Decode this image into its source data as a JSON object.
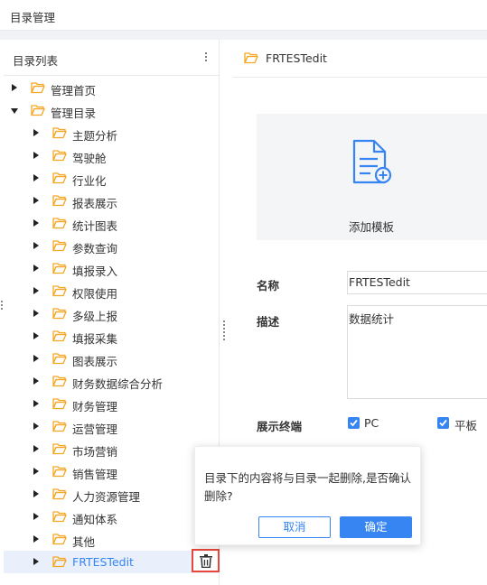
{
  "page": {
    "title": "目录管理"
  },
  "colors": {
    "accent": "#3685f2",
    "folder": "#f5a623",
    "danger": "#e8473c"
  },
  "left_panel": {
    "title": "目录列表",
    "more_icon": "vertical-dots-icon",
    "tree": [
      {
        "label": "管理首页",
        "level": 0,
        "expanded": false
      },
      {
        "label": "管理目录",
        "level": 0,
        "expanded": true
      },
      {
        "label": "主题分析",
        "level": 1,
        "expanded": false
      },
      {
        "label": "驾驶舱",
        "level": 1,
        "expanded": false
      },
      {
        "label": "行业化",
        "level": 1,
        "expanded": false
      },
      {
        "label": "报表展示",
        "level": 1,
        "expanded": false
      },
      {
        "label": "统计图表",
        "level": 1,
        "expanded": false
      },
      {
        "label": "参数查询",
        "level": 1,
        "expanded": false
      },
      {
        "label": "填报录入",
        "level": 1,
        "expanded": false
      },
      {
        "label": "权限使用",
        "level": 1,
        "expanded": false
      },
      {
        "label": "多级上报",
        "level": 1,
        "expanded": false
      },
      {
        "label": "填报采集",
        "level": 1,
        "expanded": false
      },
      {
        "label": "图表展示",
        "level": 1,
        "expanded": false
      },
      {
        "label": "财务数据综合分析",
        "level": 1,
        "expanded": false
      },
      {
        "label": "财务管理",
        "level": 1,
        "expanded": false
      },
      {
        "label": "运营管理",
        "level": 1,
        "expanded": false
      },
      {
        "label": "市场营销",
        "level": 1,
        "expanded": false
      },
      {
        "label": "销售管理",
        "level": 1,
        "expanded": false
      },
      {
        "label": "人力资源管理",
        "level": 1,
        "expanded": false
      },
      {
        "label": "通知体系",
        "level": 1,
        "expanded": false
      },
      {
        "label": "其他",
        "level": 1,
        "expanded": false
      },
      {
        "label": "FRTESTedit",
        "level": 1,
        "expanded": false,
        "selected": true
      }
    ],
    "delete_icon": "trash-icon"
  },
  "right_panel": {
    "folder_name": "FRTESTedit",
    "template_card": {
      "label": "添加模板",
      "icon": "add-document-icon"
    },
    "form": {
      "name_label": "名称",
      "name_value": "FRTESTedit",
      "desc_label": "描述",
      "desc_value": "数据统计",
      "terminal_label": "展示终端",
      "terminals": [
        {
          "label": "PC",
          "checked": true
        },
        {
          "label": "平板",
          "checked": true
        }
      ]
    }
  },
  "confirm_popover": {
    "message": "目录下的内容将与目录一起删除,是否确认删除?",
    "cancel_label": "取消",
    "ok_label": "确定"
  }
}
